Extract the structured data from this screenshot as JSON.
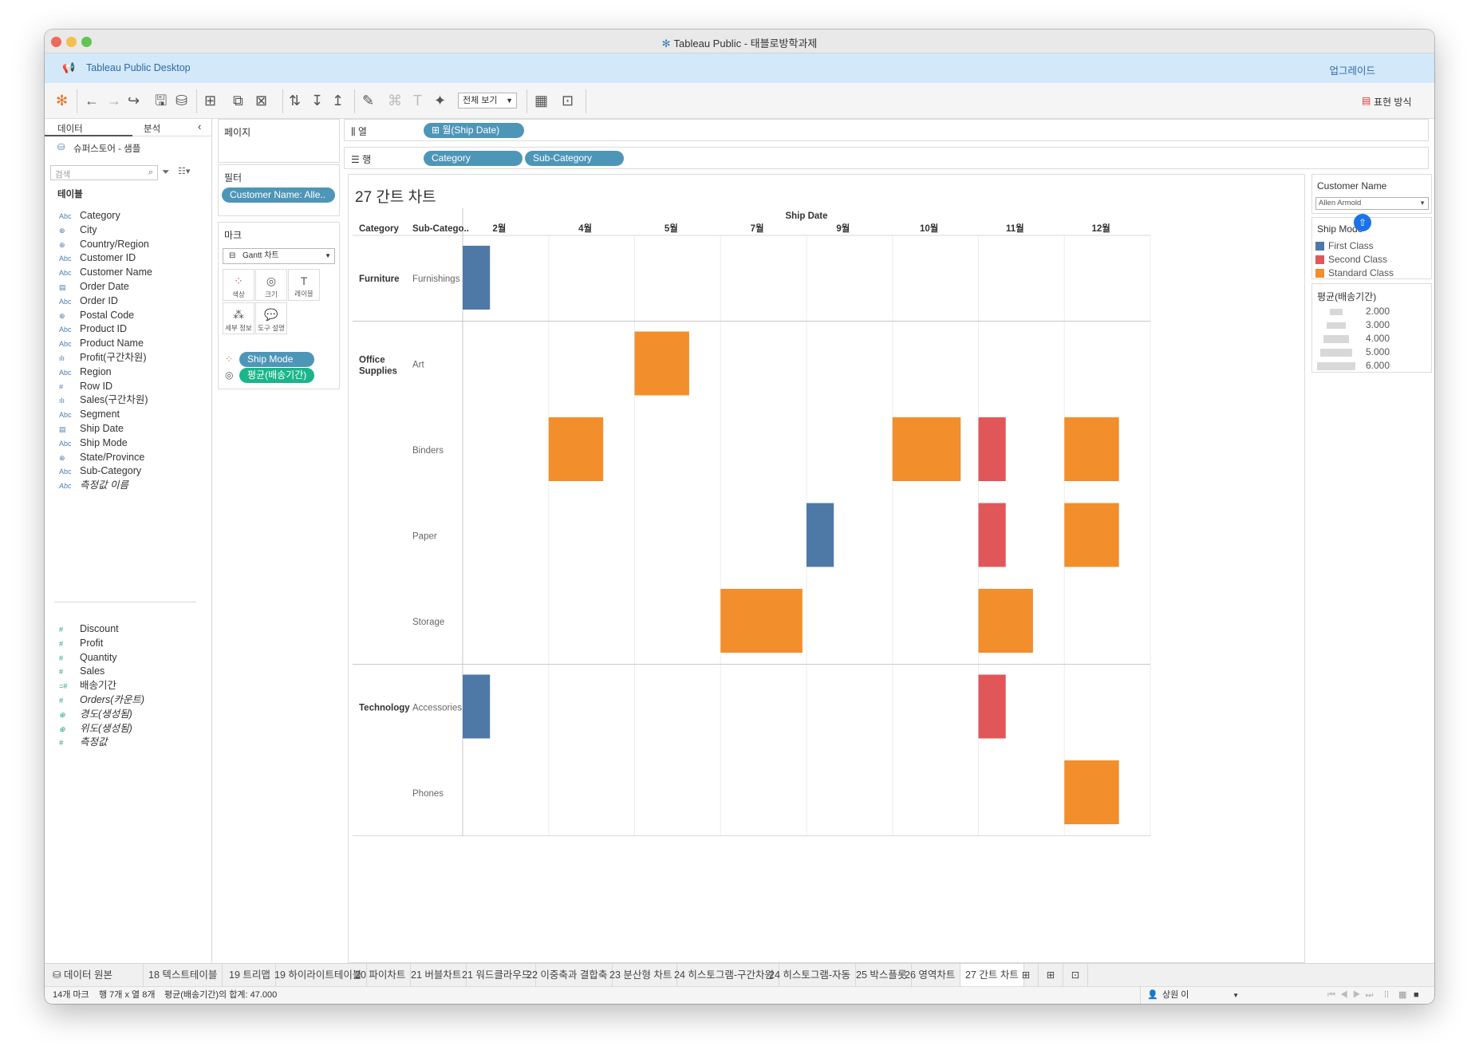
{
  "window": {
    "title": "Tableau Public - 태블로방학과제"
  },
  "banner": {
    "app_name": "Tableau Public Desktop",
    "upgrade_label": "업그레이드"
  },
  "toolbar": {
    "view_select": "전체 보기",
    "show_me_label": "표현 방식"
  },
  "left_pane": {
    "tab_data": "데이터",
    "tab_analysis": "분석",
    "datasource": "슈퍼스토어 - 샘플",
    "search_placeholder": "검색",
    "section_label": "테이블",
    "dimensions": [
      {
        "icon": "Abc",
        "label": "Category"
      },
      {
        "icon": "globe",
        "label": "City"
      },
      {
        "icon": "globe",
        "label": "Country/Region"
      },
      {
        "icon": "Abc",
        "label": "Customer ID"
      },
      {
        "icon": "Abc",
        "label": "Customer Name"
      },
      {
        "icon": "calendar",
        "label": "Order Date"
      },
      {
        "icon": "Abc",
        "label": "Order ID"
      },
      {
        "icon": "globe",
        "label": "Postal Code"
      },
      {
        "icon": "Abc",
        "label": "Product ID"
      },
      {
        "icon": "Abc",
        "label": "Product Name"
      },
      {
        "icon": "bins",
        "label": "Profit(구간차원)"
      },
      {
        "icon": "Abc",
        "label": "Region"
      },
      {
        "icon": "#",
        "label": "Row ID"
      },
      {
        "icon": "bins",
        "label": "Sales(구간차원)"
      },
      {
        "icon": "Abc",
        "label": "Segment"
      },
      {
        "icon": "calendar",
        "label": "Ship Date"
      },
      {
        "icon": "Abc",
        "label": "Ship Mode"
      },
      {
        "icon": "globe",
        "label": "State/Province"
      },
      {
        "icon": "Abc",
        "label": "Sub-Category"
      },
      {
        "icon": "Abc",
        "label": "측정값 이름"
      }
    ],
    "measures": [
      {
        "icon": "#",
        "label": "Discount"
      },
      {
        "icon": "#",
        "label": "Profit"
      },
      {
        "icon": "#",
        "label": "Quantity"
      },
      {
        "icon": "#",
        "label": "Sales"
      },
      {
        "icon": "=#",
        "label": "배송기간"
      },
      {
        "icon": "#",
        "label": "Orders(카운트)"
      },
      {
        "icon": "globe",
        "label": "경도(생성됨)"
      },
      {
        "icon": "globe",
        "label": "위도(생성됨)"
      },
      {
        "icon": "#",
        "label": "측정값"
      }
    ]
  },
  "cards": {
    "pages_label": "페이지",
    "filters_label": "필터",
    "filter_pill": "Customer Name: Alle..",
    "marks_label": "마크",
    "mark_type": "Gantt 차트",
    "mark_buttons": [
      "색상",
      "크기",
      "레이블",
      "세부 정보",
      "도구 설명"
    ],
    "mark_pills": [
      "Ship Mode",
      "평균(배송기간)"
    ]
  },
  "shelves": {
    "columns_label": "열",
    "columns_pills": [
      "월(Ship Date)"
    ],
    "rows_label": "행",
    "rows_pills": [
      "Category",
      "Sub-Category"
    ]
  },
  "viz": {
    "sheet_title": "27 간트 차트"
  },
  "chart_data": {
    "type": "gantt",
    "title": "27 간트 차트",
    "x_title": "Ship Date",
    "columns": [
      "2월",
      "4월",
      "5월",
      "7월",
      "9월",
      "10월",
      "11월",
      "12월"
    ],
    "row_header_labels": [
      "Category",
      "Sub-Catego.."
    ],
    "categories": [
      {
        "name": "Furniture",
        "subcategories": [
          "Furnishings"
        ]
      },
      {
        "name": "Office Supplies",
        "subcategories": [
          "Art",
          "Binders",
          "Paper",
          "Storage"
        ]
      },
      {
        "name": "Technology",
        "subcategories": [
          "Accessories",
          "Phones"
        ]
      }
    ],
    "marks": [
      {
        "sub": "Furnishings",
        "col": "2월",
        "ship_mode": "First Class",
        "days": 2
      },
      {
        "sub": "Art",
        "col": "5월",
        "ship_mode": "Standard Class",
        "days": 4
      },
      {
        "sub": "Binders",
        "col": "4월",
        "ship_mode": "Standard Class",
        "days": 4
      },
      {
        "sub": "Binders",
        "col": "10월",
        "ship_mode": "Standard Class",
        "days": 5
      },
      {
        "sub": "Binders",
        "col": "11월",
        "ship_mode": "Second Class",
        "days": 2
      },
      {
        "sub": "Binders",
        "col": "12월",
        "ship_mode": "Standard Class",
        "days": 4
      },
      {
        "sub": "Paper",
        "col": "9월",
        "ship_mode": "First Class",
        "days": 2
      },
      {
        "sub": "Paper",
        "col": "11월",
        "ship_mode": "Second Class",
        "days": 2
      },
      {
        "sub": "Paper",
        "col": "12월",
        "ship_mode": "Standard Class",
        "days": 4
      },
      {
        "sub": "Storage",
        "col": "7월",
        "ship_mode": "Standard Class",
        "days": 6
      },
      {
        "sub": "Storage",
        "col": "11월",
        "ship_mode": "Standard Class",
        "days": 4
      },
      {
        "sub": "Accessories",
        "col": "2월",
        "ship_mode": "First Class",
        "days": 2
      },
      {
        "sub": "Accessories",
        "col": "11월",
        "ship_mode": "Second Class",
        "days": 2
      },
      {
        "sub": "Phones",
        "col": "12월",
        "ship_mode": "Standard Class",
        "days": 4
      }
    ],
    "colors": {
      "First Class": "#4e79a7",
      "Second Class": "#e15759",
      "Standard Class": "#f28e2b"
    }
  },
  "legends": {
    "customer_filter_title": "Customer Name",
    "customer_filter_value": "Allen Armold",
    "ship_mode_title": "Ship Mode",
    "ship_modes": [
      {
        "label": "First Class",
        "color": "#4e79a7"
      },
      {
        "label": "Second Class",
        "color": "#e15759"
      },
      {
        "label": "Standard Class",
        "color": "#f28e2b"
      }
    ],
    "size_title": "평균(배송기간)",
    "size_items": [
      {
        "label": "2.000",
        "value": 2
      },
      {
        "label": "3.000",
        "value": 3
      },
      {
        "label": "4.000",
        "value": 4
      },
      {
        "label": "5.000",
        "value": 5
      },
      {
        "label": "6.000",
        "value": 6
      }
    ]
  },
  "tabs": {
    "datasource_tab": "데이터 원본",
    "sheets": [
      "18 텍스트테이블",
      "19 트리맵",
      "19 하이라이트테이블",
      "20 파이차트",
      "21 버블차트",
      "21 워드클라우드",
      "22 이중축과 결합축",
      "23 분산형 차트",
      "24 히스토그램-구간차원",
      "24 히스토그램-자동",
      "25 박스플롯",
      "26 영역차트",
      "27 간트 차트"
    ],
    "active": "27 간트 차트"
  },
  "status": {
    "marks": "14개 마크",
    "rows_cols": "행 7개 x 열 8개",
    "sum": "평균(배송기간)의 합계: 47.000",
    "user": "상원 이"
  }
}
